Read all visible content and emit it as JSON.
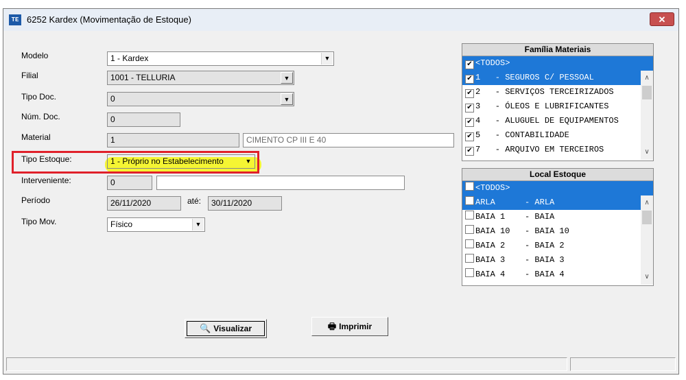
{
  "window": {
    "title": "6252 Kardex (Movimentação de Estoque)",
    "icon_text": "TE",
    "close_symbol": "✕"
  },
  "form": {
    "modelo": {
      "label": "Modelo",
      "value": "1 - Kardex"
    },
    "filial": {
      "label": "Filial",
      "value": "1001 - TELLURIA"
    },
    "tipo_doc": {
      "label": "Tipo Doc.",
      "value": "0"
    },
    "num_doc": {
      "label": "Núm. Doc.",
      "value": "0"
    },
    "material": {
      "label": "Material",
      "code": "1",
      "description": "CIMENTO CP III E 40"
    },
    "tipo_estoque": {
      "label": "Tipo Estoque:",
      "value": "1 - Próprio no Estabelecimento"
    },
    "interveniente": {
      "label": "Interveniente:",
      "code": "0",
      "description": ""
    },
    "periodo": {
      "label": "Período",
      "start": "26/11/2020",
      "ate_label": "até:",
      "end": "30/11/2020"
    },
    "tipo_mov": {
      "label": "Tipo Mov.",
      "value": "Físico"
    }
  },
  "familia": {
    "header": "Família Materiais",
    "items": [
      {
        "text": "<TODOS>",
        "checked": true,
        "selected": true
      },
      {
        "text": "1   - SEGUROS C/ PESSOAL",
        "checked": true,
        "selected": true
      },
      {
        "text": "2   - SERVIÇOS TERCEIRIZADOS",
        "checked": true,
        "selected": false
      },
      {
        "text": "3   - ÓLEOS E LUBRIFICANTES",
        "checked": true,
        "selected": false
      },
      {
        "text": "4   - ALUGUEL DE EQUIPAMENTOS",
        "checked": true,
        "selected": false
      },
      {
        "text": "5   - CONTABILIDADE",
        "checked": true,
        "selected": false
      },
      {
        "text": "7   - ARQUIVO EM TERCEIROS",
        "checked": true,
        "selected": false
      }
    ]
  },
  "local": {
    "header": "Local Estoque",
    "items": [
      {
        "text": "<TODOS>",
        "checked": false,
        "selected": true
      },
      {
        "text": "ARLA      - ARLA",
        "checked": false,
        "selected": true
      },
      {
        "text": "BAIA 1    - BAIA",
        "checked": false,
        "selected": false
      },
      {
        "text": "BAIA 10   - BAIA 10",
        "checked": false,
        "selected": false
      },
      {
        "text": "BAIA 2    - BAIA 2",
        "checked": false,
        "selected": false
      },
      {
        "text": "BAIA 3    - BAIA 3",
        "checked": false,
        "selected": false
      },
      {
        "text": "BAIA 4    - BAIA 4",
        "checked": false,
        "selected": false
      }
    ]
  },
  "buttons": {
    "visualizar": "Visualizar",
    "imprimir": "Imprimir"
  },
  "icons": {
    "dropdown": "▼",
    "scroll_up": "∧",
    "scroll_down": "∨",
    "check": "✔",
    "preview": "🔍",
    "printer": "🖶"
  },
  "colors": {
    "selection": "#1e78d7",
    "highlight": "#f5f51e",
    "red_box": "#e0202a",
    "close": "#c75050"
  }
}
